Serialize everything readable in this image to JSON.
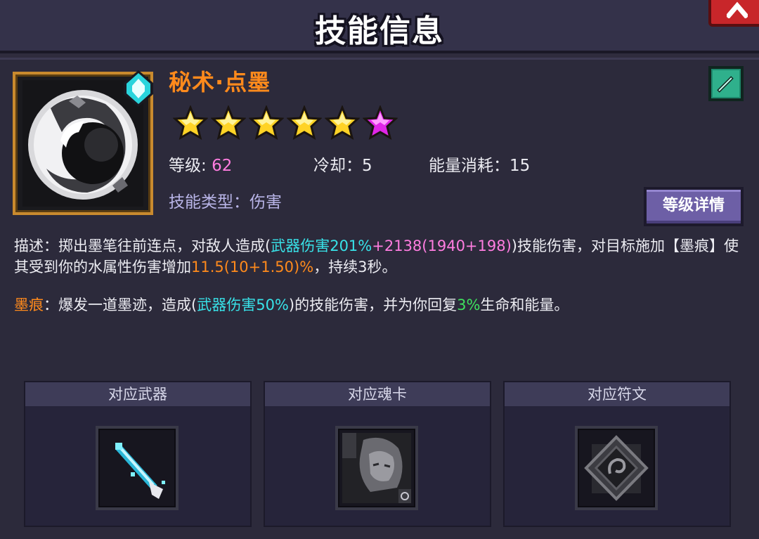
{
  "header": {
    "title": "技能信息"
  },
  "skill": {
    "name": "秘术·点墨",
    "stars": [
      {
        "color": "gold"
      },
      {
        "color": "gold"
      },
      {
        "color": "gold"
      },
      {
        "color": "gold"
      },
      {
        "color": "gold"
      },
      {
        "color": "purple"
      }
    ],
    "stats": {
      "level_label": "等级: ",
      "level_value": "62",
      "cooldown_label": "冷却：",
      "cooldown_value": "5",
      "energy_label": "能量消耗：",
      "energy_value": "15"
    },
    "type_label": "技能类型：",
    "type_value": "伤害",
    "level_detail_button": "等级详情"
  },
  "description": {
    "prefix": "描述：掷出墨笔往前连点，对敌人造成(",
    "weapon_damage": "武器伤害201%",
    "plus": "+2138(1940+198)",
    "after_damage": ")技能伤害，对目标施加【墨痕】使其受到你的水属性伤害增加",
    "increase": "11.5(10+1.50)%",
    "suffix": "，持续3秒。"
  },
  "mark": {
    "name": "墨痕",
    "prefix": "：爆发一道墨迹，造成(",
    "weapon_damage": "武器伤害50%",
    "middle": ")的技能伤害，并为你回复",
    "heal": "3%",
    "suffix": "生命和能量。"
  },
  "cards": [
    {
      "title": "对应武器",
      "icon": "brush-weapon-icon"
    },
    {
      "title": "对应魂卡",
      "icon": "soul-card-icon"
    },
    {
      "title": "对应符文",
      "icon": "rune-icon"
    }
  ],
  "colors": {
    "accent_orange": "#ff8a1c",
    "cyan": "#38e2e8",
    "pink": "#ff7de0",
    "green": "#3ee05e",
    "button_purple": "#6d5fa6"
  }
}
